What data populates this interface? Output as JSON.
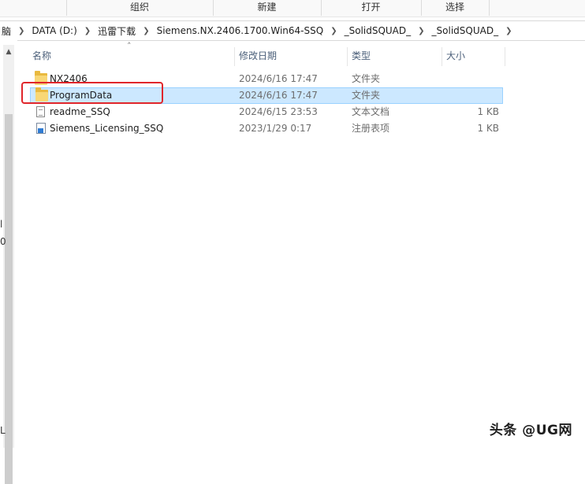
{
  "ribbon": {
    "groups": [
      "组织",
      "新建",
      "打开",
      "选择"
    ]
  },
  "breadcrumb": {
    "items": [
      "脑",
      "DATA (D:)",
      "迅雷下载",
      "Siemens.NX.2406.1700.Win64-SSQ",
      "_SolidSQUAD_",
      "_SolidSQUAD_"
    ]
  },
  "left_pane": {
    "glyphs": [
      "l",
      "0",
      "L"
    ]
  },
  "columns": {
    "name": "名称",
    "modified": "修改日期",
    "type": "类型",
    "size": "大小"
  },
  "files": [
    {
      "name": "NX2406",
      "modified": "2024/6/16 17:47",
      "type": "文件夹",
      "size": "",
      "icon": "folder-icon",
      "selected": false
    },
    {
      "name": "ProgramData",
      "modified": "2024/6/16 17:47",
      "type": "文件夹",
      "size": "",
      "icon": "folder-icon",
      "selected": true
    },
    {
      "name": "readme_SSQ",
      "modified": "2024/6/15 23:53",
      "type": "文本文档",
      "size": "1 KB",
      "icon": "text-file-icon",
      "selected": false
    },
    {
      "name": "Siemens_Licensing_SSQ",
      "modified": "2023/1/29 0:17",
      "type": "注册表项",
      "size": "1 KB",
      "icon": "registry-file-icon",
      "selected": false
    }
  ],
  "highlight_color": "#e0262b",
  "selection_color": "#cce8ff",
  "watermark": "头条 @UG网"
}
